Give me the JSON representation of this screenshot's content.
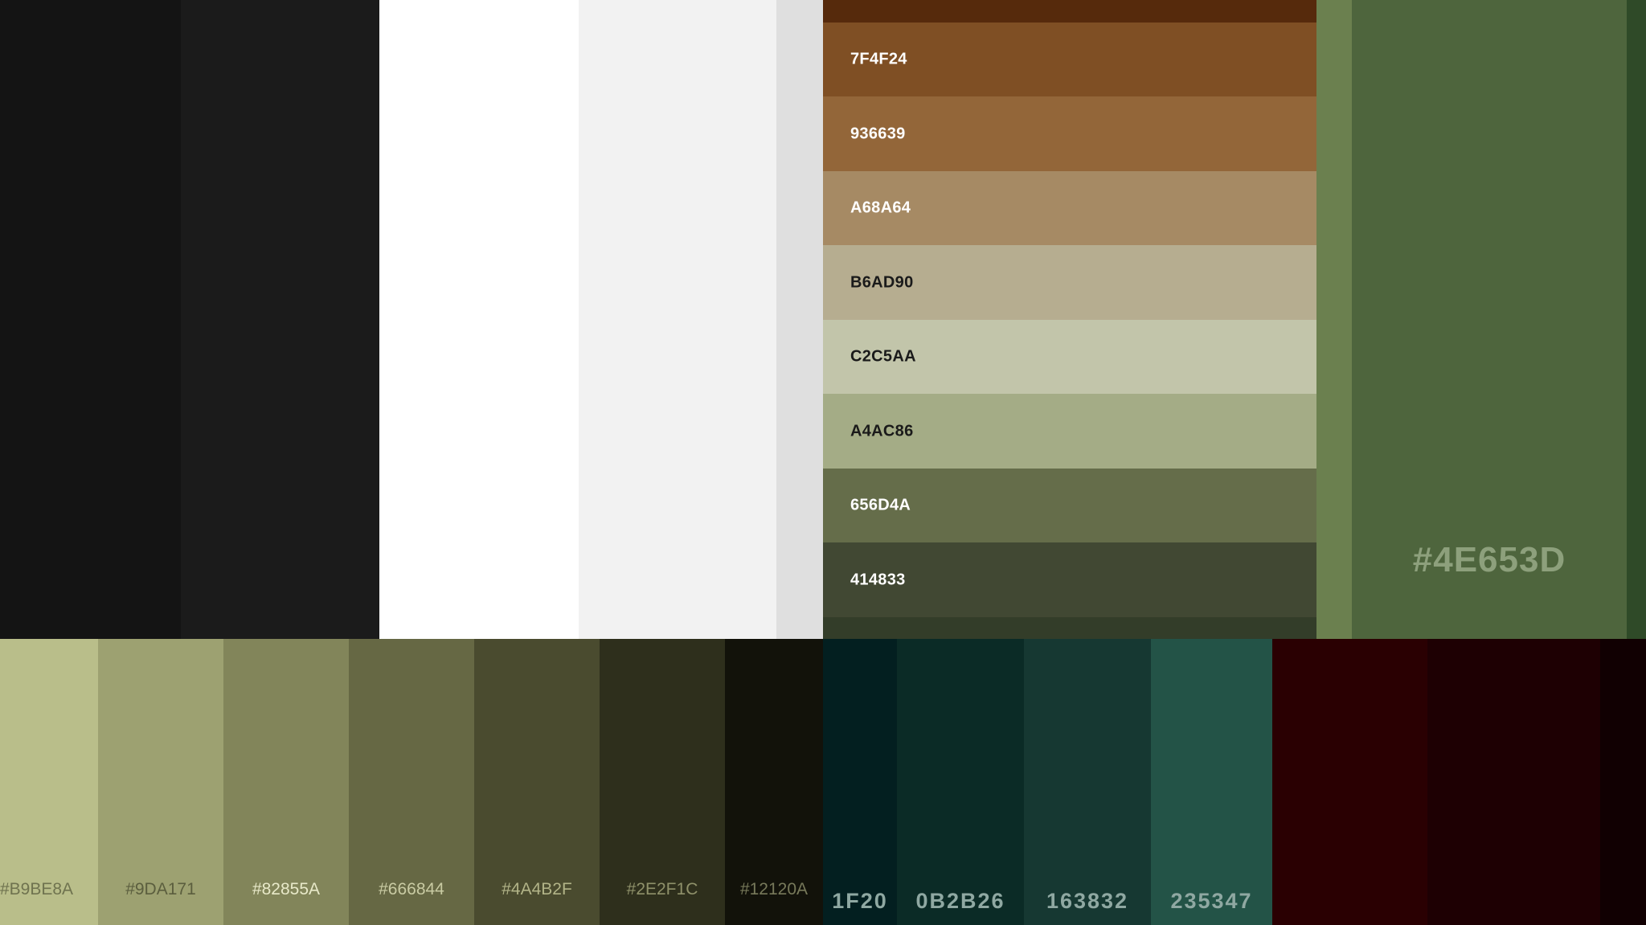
{
  "top_left_swatches": [
    {
      "color": "#141414"
    },
    {
      "color": "#1b1b1b"
    },
    {
      "color": "#ffffff"
    },
    {
      "color": "#f2f2f2"
    },
    {
      "color": "#dfdfdf"
    }
  ],
  "strip_palette": [
    {
      "label": "",
      "color": "#562A0C"
    },
    {
      "label": "7F4F24",
      "color": "#7F4F24",
      "text_color": "#ffffff"
    },
    {
      "label": "936639",
      "color": "#936639",
      "text_color": "#ffffff"
    },
    {
      "label": "A68A64",
      "color": "#A68A64",
      "text_color": "#ffffff"
    },
    {
      "label": "B6AD90",
      "color": "#B6AD90",
      "text_color": "#1a1a1a"
    },
    {
      "label": "C2C5AA",
      "color": "#C2C5AA",
      "text_color": "#1a1a1a"
    },
    {
      "label": "A4AC86",
      "color": "#A4AC86",
      "text_color": "#1a1a1a"
    },
    {
      "label": "656D4A",
      "color": "#656D4A",
      "text_color": "#ffffff"
    },
    {
      "label": "414833",
      "color": "#414833",
      "text_color": "#ffffff"
    },
    {
      "label": "",
      "color": "#333D29"
    }
  ],
  "green_block": {
    "label": "#4E653D",
    "colors": [
      "#6B804F",
      "#4E653D",
      "#2F4A28"
    ]
  },
  "olive_palette": [
    {
      "label": "#B9BE8A",
      "color": "#B9BE8A",
      "text_color": "#6f734f"
    },
    {
      "label": "#9DA171",
      "color": "#9DA171",
      "text_color": "#5b5e3e"
    },
    {
      "label": "#82855A",
      "color": "#82855A",
      "text_color": "#e8e9c9"
    },
    {
      "label": "#666844",
      "color": "#666844",
      "text_color": "#c9cba3"
    },
    {
      "label": "#4A4B2F",
      "color": "#4A4B2F",
      "text_color": "#b2b488"
    },
    {
      "label": "#2E2F1C",
      "color": "#2E2F1C",
      "text_color": "#8f916a"
    },
    {
      "label": "#12120A",
      "color": "#12120A",
      "text_color": "#77795a"
    }
  ],
  "teal_palette": [
    {
      "label": "1F20",
      "color": "#031F20"
    },
    {
      "label": "0B2B26",
      "color": "#0B2B26"
    },
    {
      "label": "163832",
      "color": "#163832"
    },
    {
      "label": "235347",
      "color": "#235347"
    }
  ],
  "red_swatches": [
    {
      "color": "#2A0002"
    },
    {
      "color": "#1E0003"
    },
    {
      "color": "#110002"
    }
  ]
}
